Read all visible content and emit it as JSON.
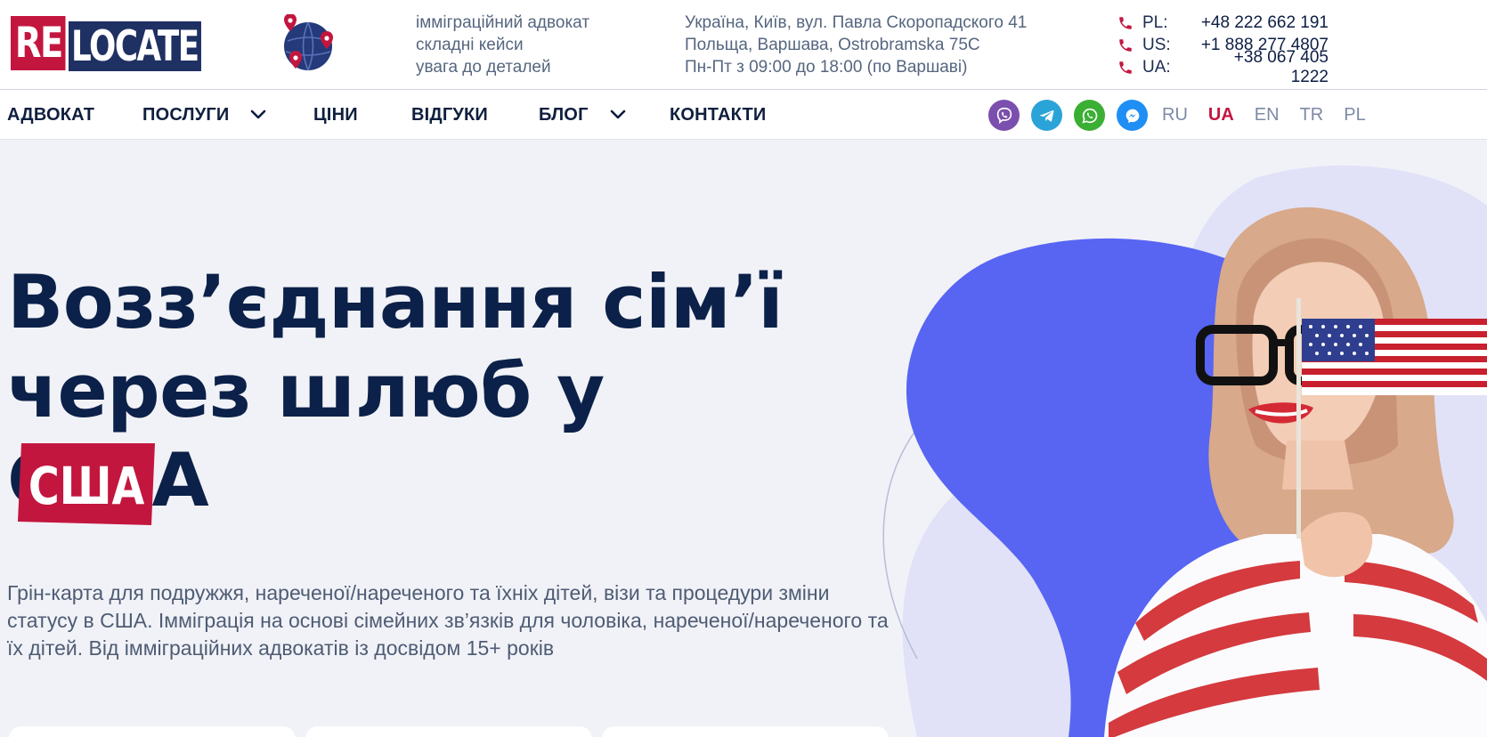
{
  "header": {
    "logo": {
      "part1": "RE",
      "part2": "LOCATE"
    },
    "tagline": [
      "імміграційний адвокат",
      "складні кейси",
      "увага до деталей"
    ],
    "address": [
      "Україна, Київ, вул. Павла Скоропадского 41",
      "Польща, Варшава, Ostrobramska 75C",
      "Пн-Пт з 09:00 до 18:00 (по Варшаві)"
    ],
    "phones": [
      {
        "label": "PL:",
        "number": "+48 222 662 191"
      },
      {
        "label": "US:",
        "number": "+1 888 277 4807"
      },
      {
        "label": "UA:",
        "number": "+38 067 405 1222"
      }
    ]
  },
  "nav": {
    "items": [
      {
        "label": "АДВОКАТ",
        "dropdown": false
      },
      {
        "label": "ПОСЛУГИ",
        "dropdown": true
      },
      {
        "label": "ЦІНИ",
        "dropdown": false
      },
      {
        "label": "ВІДГУКИ",
        "dropdown": false
      },
      {
        "label": "БЛОГ",
        "dropdown": true
      },
      {
        "label": "КОНТАКТИ",
        "dropdown": false
      }
    ],
    "socials": [
      {
        "name": "viber-icon",
        "color": "#7b4fad"
      },
      {
        "name": "telegram-icon",
        "color": "#2aa3d8"
      },
      {
        "name": "whatsapp-icon",
        "color": "#3aaf33"
      },
      {
        "name": "messenger-icon",
        "color": "#1f8ff5"
      }
    ],
    "languages": [
      {
        "code": "RU",
        "active": false
      },
      {
        "code": "UA",
        "active": true
      },
      {
        "code": "EN",
        "active": false
      },
      {
        "code": "TR",
        "active": false
      },
      {
        "code": "PL",
        "active": false
      }
    ]
  },
  "hero": {
    "title_line1": "Возз’єднання сім’ї",
    "title_line2": "через шлюб у США",
    "badge": "США",
    "description": "Грін-карта для подружжя, нареченої/нареченого та їхніх дітей, візи та процедури зміни статусу в США. Імміграція на основі сімейних зв’язків для чоловіка, нареченої/нареченого та їх дітей. Від імміграційних адвокатів із досвідом 15+ років"
  },
  "colors": {
    "accent": "#c3163f",
    "navy": "#1f3063",
    "blob": "#5765f2",
    "background": "#f1f2f7"
  }
}
